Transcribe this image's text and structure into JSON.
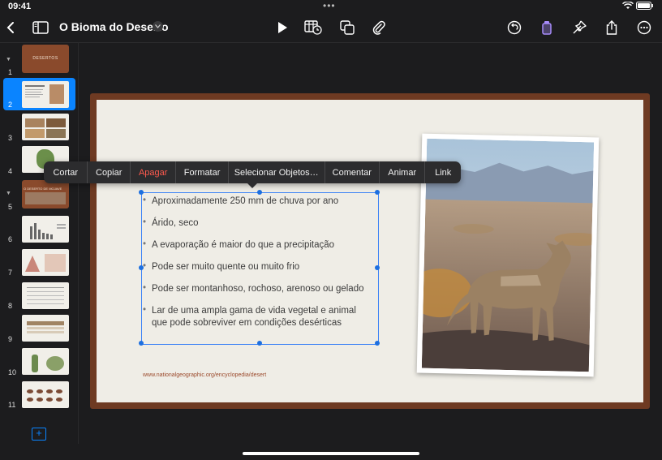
{
  "status": {
    "time": "09:41",
    "battery": "100%"
  },
  "toolbar": {
    "title": "O Bioma do Deserto"
  },
  "slides": [
    {
      "num": "1",
      "title": "DESERTOS"
    },
    {
      "num": "2"
    },
    {
      "num": "3"
    },
    {
      "num": "4"
    },
    {
      "num": "5",
      "title": "O DESERTO DE MOJAVE"
    },
    {
      "num": "6"
    },
    {
      "num": "7"
    },
    {
      "num": "8"
    },
    {
      "num": "9"
    },
    {
      "num": "10"
    },
    {
      "num": "11"
    }
  ],
  "context_menu": {
    "items": [
      "Cortar",
      "Copiar",
      "Apagar",
      "Formatar",
      "Selecionar Objetos…",
      "Comentar",
      "Animar",
      "Link"
    ]
  },
  "slide_content": {
    "bullets": [
      "Aproximadamente 250 mm de chuva por ano",
      "Árido, seco",
      "A evaporação é maior do que a precipitação",
      "Pode ser muito quente ou muito frio",
      "Pode ser montanhoso, rochoso, arenoso ou gelado",
      "Lar de uma ampla gama de vida vegetal e animal",
      "que pode sobreviver em condições desérticas"
    ],
    "bullet_marker": "•",
    "url": "www.nationalgeographic.org/encyclopedia/desert"
  },
  "colors": {
    "accent": "#0a84ff",
    "danger": "#ff5a4e",
    "frame": "#6e3a22"
  }
}
